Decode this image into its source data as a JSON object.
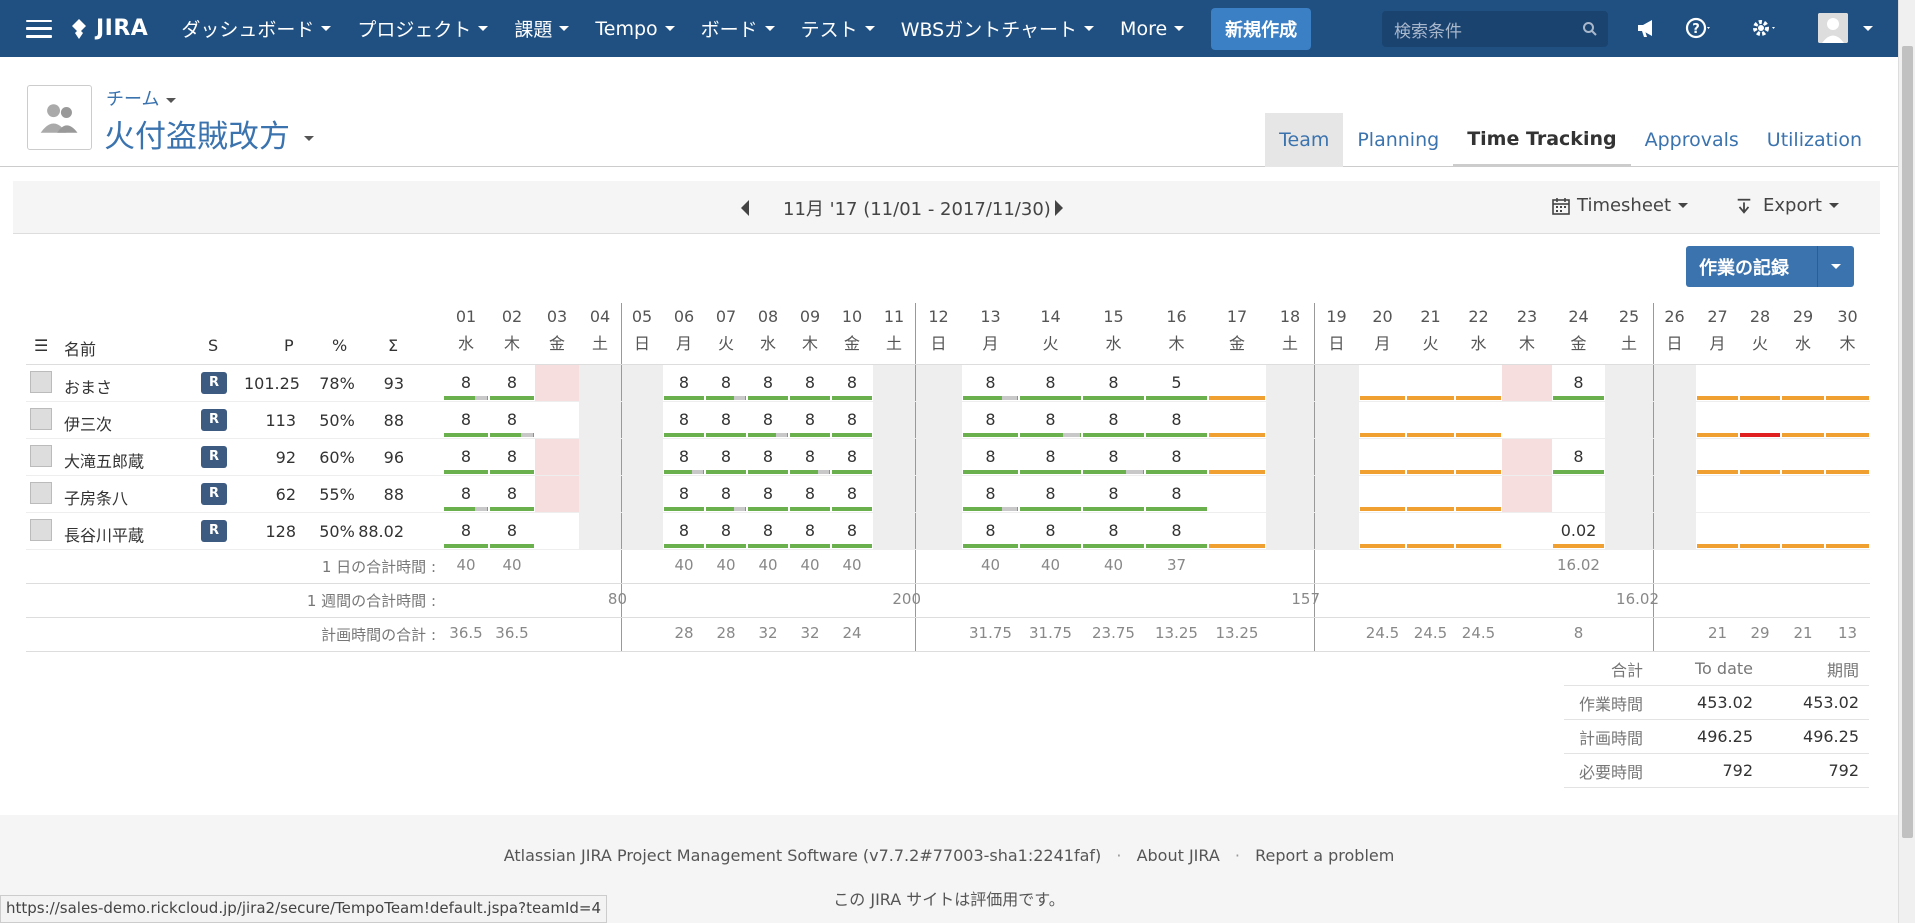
{
  "topbar": {
    "product": "JIRA",
    "nav": [
      "ダッシュボード",
      "プロジェクト",
      "課題",
      "Tempo",
      "ボード",
      "テスト",
      "WBSガントチャート",
      "More"
    ],
    "create_label": "新規作成",
    "search_placeholder": "検索条件",
    "icons": [
      "menu-icon",
      "jira-logo-icon",
      "search-icon",
      "megaphone-icon",
      "help-icon",
      "gear-icon",
      "user-avatar"
    ]
  },
  "header": {
    "team_label": "チーム",
    "team_name": "火付盗賊改方",
    "tabs": [
      "Team",
      "Planning",
      "Time Tracking",
      "Approvals",
      "Utilization"
    ],
    "active_tab": "Time Tracking"
  },
  "period": {
    "label": "11月 '17 (11/01 - 2017/11/30)",
    "timesheet_label": "Timesheet",
    "export_label": "Export"
  },
  "log_button": {
    "label": "作業の記録"
  },
  "table": {
    "headers": {
      "name": "名前",
      "s": "S",
      "p": "P",
      "pct": "%",
      "sigma": "Σ"
    },
    "days": [
      {
        "d": "01",
        "w": "水"
      },
      {
        "d": "02",
        "w": "木"
      },
      {
        "d": "03",
        "w": "金"
      },
      {
        "d": "04",
        "w": "土"
      },
      {
        "d": "05",
        "w": "日"
      },
      {
        "d": "06",
        "w": "月"
      },
      {
        "d": "07",
        "w": "火"
      },
      {
        "d": "08",
        "w": "水"
      },
      {
        "d": "09",
        "w": "木"
      },
      {
        "d": "10",
        "w": "金"
      },
      {
        "d": "11",
        "w": "土"
      },
      {
        "d": "12",
        "w": "日"
      },
      {
        "d": "13",
        "w": "月"
      },
      {
        "d": "14",
        "w": "火"
      },
      {
        "d": "15",
        "w": "水"
      },
      {
        "d": "16",
        "w": "木"
      },
      {
        "d": "17",
        "w": "金"
      },
      {
        "d": "18",
        "w": "土"
      },
      {
        "d": "19",
        "w": "日"
      },
      {
        "d": "20",
        "w": "月"
      },
      {
        "d": "21",
        "w": "火"
      },
      {
        "d": "22",
        "w": "水"
      },
      {
        "d": "23",
        "w": "木"
      },
      {
        "d": "24",
        "w": "金"
      },
      {
        "d": "25",
        "w": "土"
      },
      {
        "d": "26",
        "w": "日"
      },
      {
        "d": "27",
        "w": "月"
      },
      {
        "d": "28",
        "w": "火"
      },
      {
        "d": "29",
        "w": "水"
      },
      {
        "d": "30",
        "w": "木"
      }
    ],
    "users": [
      {
        "name": "おまさ",
        "status": "R",
        "p": "101.25",
        "pct": "78%",
        "sigma": "93",
        "hours": [
          "8",
          "8",
          "",
          "",
          "",
          "8",
          "8",
          "8",
          "8",
          "8",
          "",
          "",
          "8",
          "8",
          "8",
          "5",
          "",
          "",
          "",
          "",
          "",
          "",
          "",
          "8",
          "",
          "",
          "",
          "",
          "",
          ""
        ]
      },
      {
        "name": "伊三次",
        "status": "R",
        "p": "113",
        "pct": "50%",
        "sigma": "88",
        "hours": [
          "8",
          "8",
          "",
          "",
          "",
          "8",
          "8",
          "8",
          "8",
          "8",
          "",
          "",
          "8",
          "8",
          "8",
          "8",
          "",
          "",
          "",
          "",
          "",
          "",
          "",
          "",
          "",
          "",
          "",
          "",
          "",
          ""
        ]
      },
      {
        "name": "大滝五郎蔵",
        "status": "R",
        "p": "92",
        "pct": "60%",
        "sigma": "96",
        "hours": [
          "8",
          "8",
          "",
          "",
          "",
          "8",
          "8",
          "8",
          "8",
          "8",
          "",
          "",
          "8",
          "8",
          "8",
          "8",
          "",
          "",
          "",
          "",
          "",
          "",
          "",
          "8",
          "",
          "",
          "",
          "",
          "",
          ""
        ]
      },
      {
        "name": "子房条八",
        "status": "R",
        "p": "62",
        "pct": "55%",
        "sigma": "88",
        "hours": [
          "8",
          "8",
          "",
          "",
          "",
          "8",
          "8",
          "8",
          "8",
          "8",
          "",
          "",
          "8",
          "8",
          "8",
          "8",
          "",
          "",
          "",
          "",
          "",
          "",
          "",
          "",
          "",
          "",
          "",
          "",
          "",
          ""
        ]
      },
      {
        "name": "長谷川平蔵",
        "status": "R",
        "p": "128",
        "pct": "50%",
        "sigma": "88.02",
        "hours": [
          "8",
          "8",
          "",
          "",
          "",
          "8",
          "8",
          "8",
          "8",
          "8",
          "",
          "",
          "8",
          "8",
          "8",
          "8",
          "",
          "",
          "",
          "",
          "",
          "",
          "",
          "0.02",
          "",
          "",
          "",
          "",
          "",
          ""
        ]
      }
    ],
    "daily_total_label": "1 日の合計時間 :",
    "daily_totals": [
      "40",
      "40",
      "",
      "",
      "",
      "40",
      "40",
      "40",
      "40",
      "40",
      "",
      "",
      "40",
      "40",
      "40",
      "37",
      "",
      "",
      "",
      "",
      "",
      "",
      "",
      "16.02",
      "",
      "",
      "",
      "",
      "",
      ""
    ],
    "weekly_total_label": "1 週間の合計時間 :",
    "weekly_totals": [
      "80",
      "200",
      "157",
      "16.02"
    ],
    "planned_total_label": "計画時間の合計 :",
    "planned_totals": [
      "36.5",
      "36.5",
      "",
      "",
      "",
      "28",
      "28",
      "32",
      "32",
      "24",
      "",
      "",
      "31.75",
      "31.75",
      "23.75",
      "13.25",
      "13.25",
      "",
      "",
      "24.5",
      "24.5",
      "24.5",
      "",
      "8",
      "",
      "",
      "21",
      "29",
      "21",
      "13"
    ]
  },
  "totals": {
    "headers": [
      "合計",
      "To date",
      "期間"
    ],
    "rows": [
      [
        "作業時間",
        "453.02",
        "453.02"
      ],
      [
        "計画時間",
        "496.25",
        "496.25"
      ],
      [
        "必要時間",
        "792",
        "792"
      ]
    ]
  },
  "footer": {
    "line1": "Atlassian JIRA Project Management Software (v7.7.2#77003-sha1:2241faf)",
    "about": "About JIRA",
    "report": "Report a problem",
    "line2": "この JIRA サイトは評価用です。"
  },
  "statusbar": "https://sales-demo.rickcloud.jp/jira2/secure/TempoTeam!default.jspa?teamId=4",
  "colors": {
    "brand": "#205081",
    "link": "#3b73af",
    "green": "#6ab04c",
    "orange": "#f0a030",
    "red": "#e02020",
    "gray": "#c8c8c8",
    "pink": "#f6dede",
    "weekend": "#eeeeee"
  }
}
